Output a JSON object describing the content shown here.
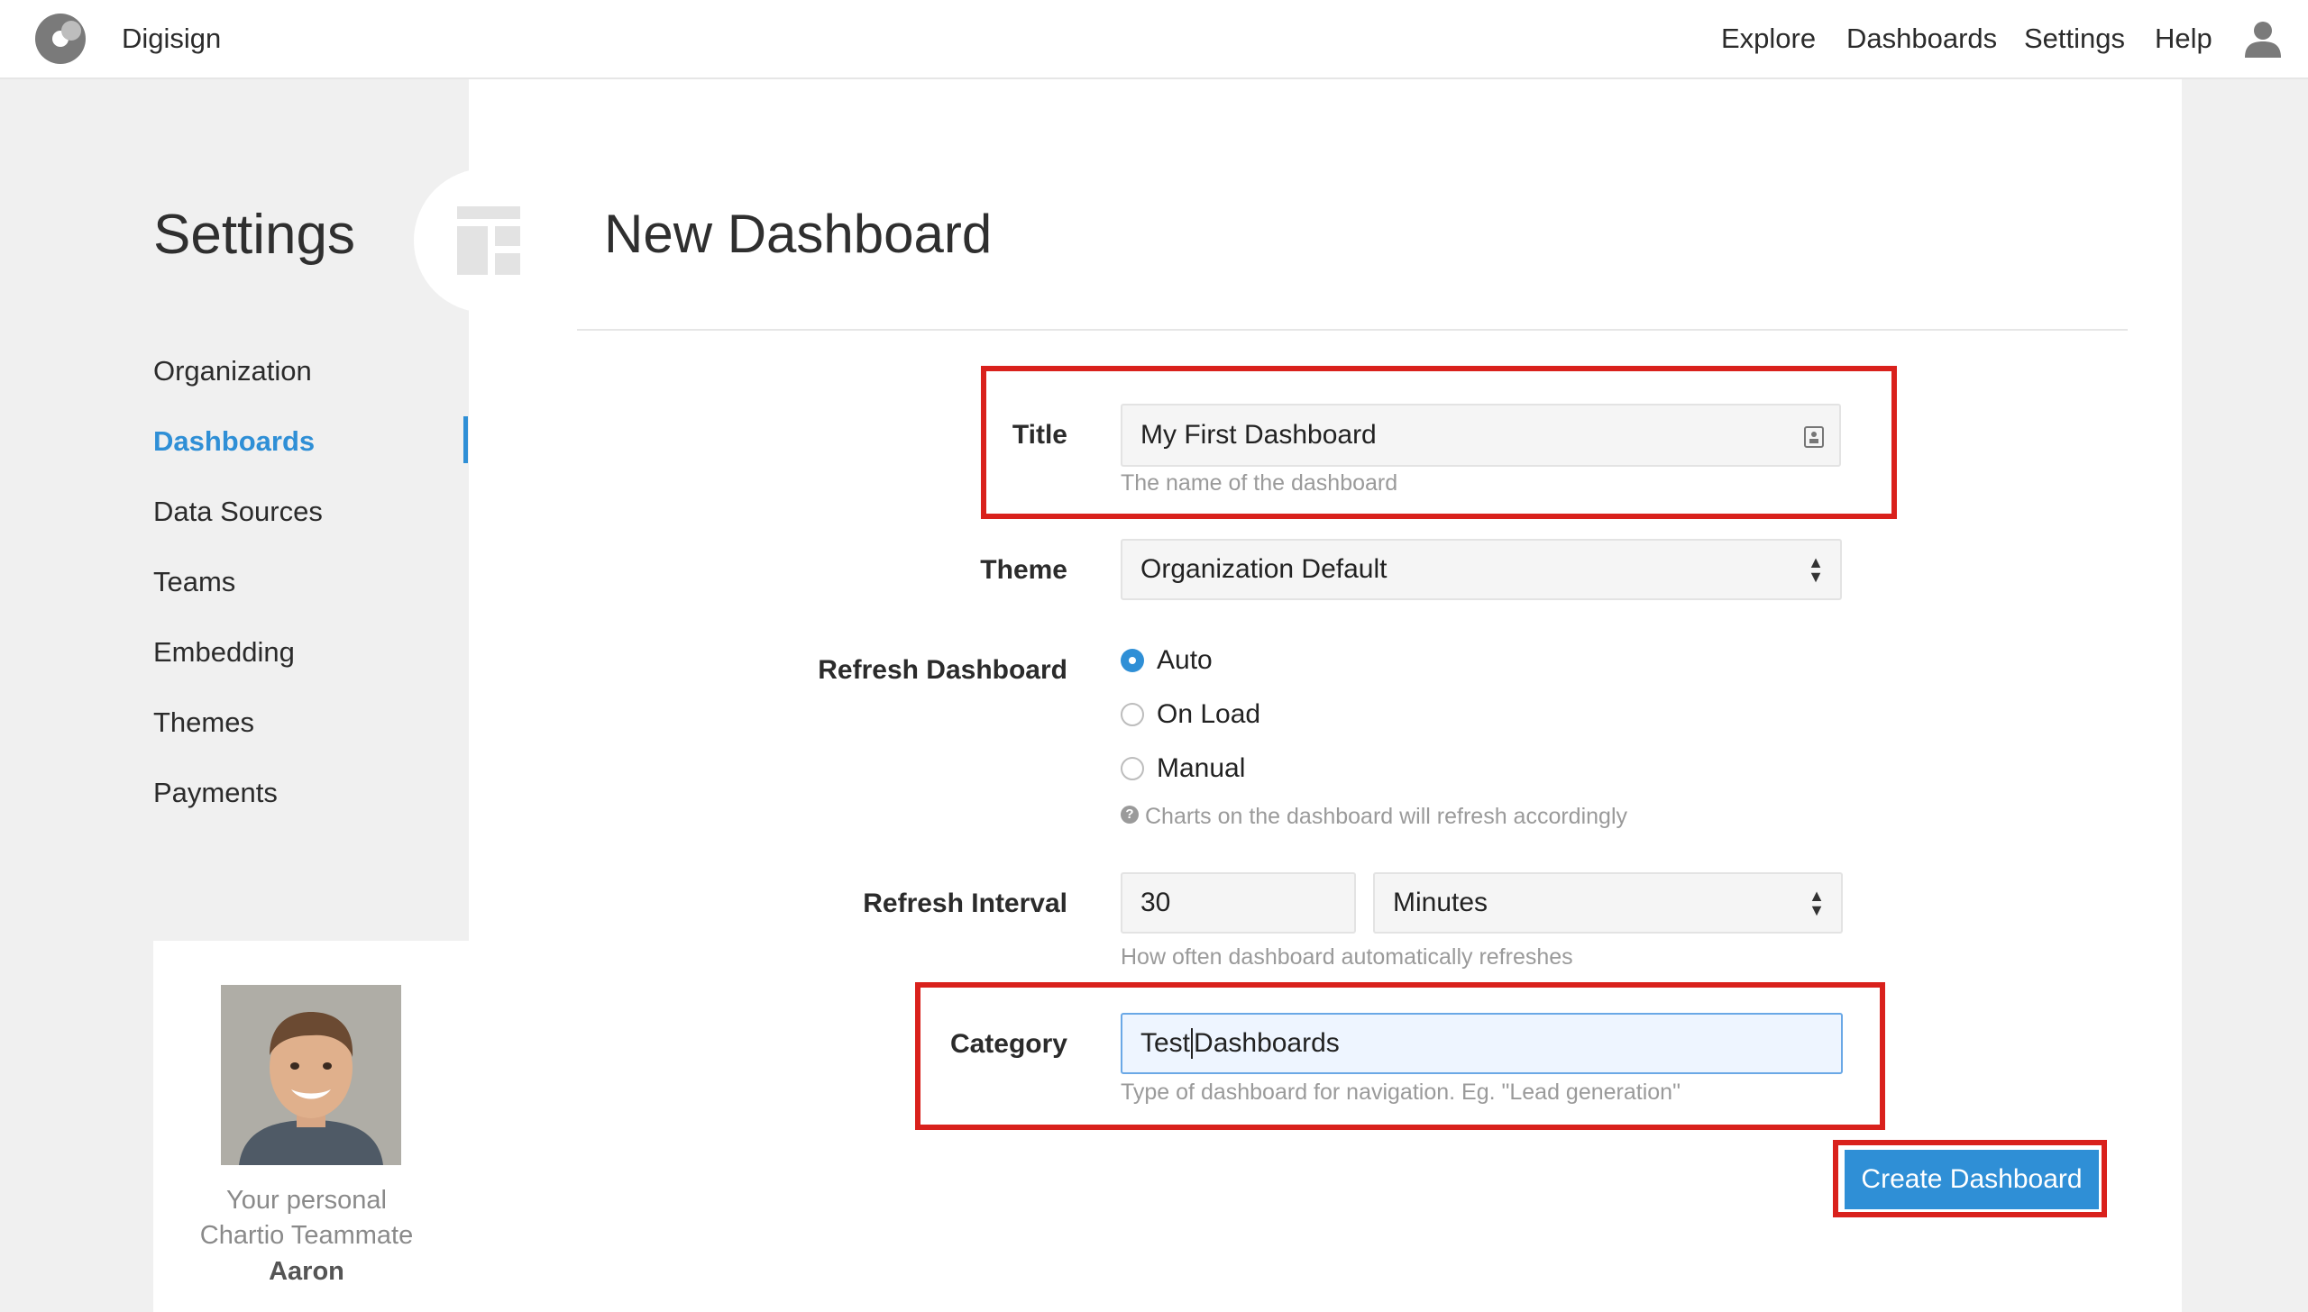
{
  "app": {
    "brand": "Digisign"
  },
  "nav": {
    "links": [
      "Explore",
      "Dashboards",
      "Settings",
      "Help"
    ]
  },
  "sidebar": {
    "title": "Settings",
    "items": [
      {
        "label": "Organization"
      },
      {
        "label": "Dashboards",
        "active": true
      },
      {
        "label": "Data Sources"
      },
      {
        "label": "Teams"
      },
      {
        "label": "Embedding"
      },
      {
        "label": "Themes"
      },
      {
        "label": "Payments"
      }
    ],
    "teammate": {
      "line1": "Your personal",
      "line2": "Chartio Teammate",
      "name": "Aaron"
    }
  },
  "main": {
    "title": "New Dashboard",
    "form": {
      "title_label": "Title",
      "title_value": "My First Dashboard",
      "title_help": "The name of the dashboard",
      "theme_label": "Theme",
      "theme_value": "Organization Default",
      "refresh_label": "Refresh Dashboard",
      "refresh_options": [
        "Auto",
        "On Load",
        "Manual"
      ],
      "refresh_selected": "Auto",
      "refresh_help": "Charts on the dashboard will refresh accordingly",
      "interval_label": "Refresh Interval",
      "interval_value": "30",
      "interval_unit": "Minutes",
      "interval_help": "How often dashboard automatically refreshes",
      "category_label": "Category",
      "category_value_before_cursor": "Test",
      "category_value_after_cursor": "Dashboards",
      "category_help": "Type of dashboard for navigation. Eg. \"Lead generation\"",
      "submit_label": "Create Dashboard"
    }
  },
  "colors": {
    "accent": "#2f8fd6",
    "highlight_box": "#d9211c",
    "sidebar_bg": "#f0f0f0"
  }
}
